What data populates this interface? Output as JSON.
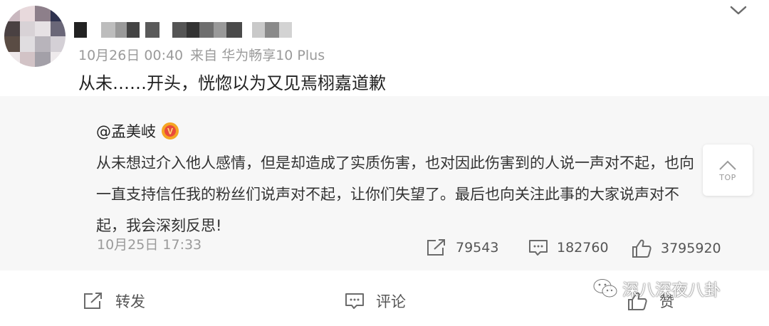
{
  "post": {
    "timestamp": "10月26日 00:40",
    "source": "来自 华为畅享10 Plus",
    "text": "从未……开头，恍惚以为又见焉栩嘉道歉"
  },
  "repost": {
    "username": "@孟美岐",
    "verified_badge": "V",
    "text": "从未想过介入他人感情，但是却造成了实质伤害，也对因此伤害到的人说一声对不起，也向一直支持信任我的粉丝们说声对不起，让你们失望了。最后也向关注此事的大家说声对不起，我会深刻反思!",
    "timestamp": "10月25日 17:33",
    "share_count": "79543",
    "comment_count": "182760",
    "like_count": "3795920"
  },
  "top_button": {
    "label": "TOP"
  },
  "actions": {
    "forward_label": "转发",
    "comment_label": "评论",
    "like_label": "赞"
  },
  "watermark": {
    "text": "深八深夜八卦"
  },
  "colors": {
    "meta_gray": "#9a9a9a",
    "repost_bg": "#f7f7f7",
    "verified_orange": "#f5a623"
  }
}
